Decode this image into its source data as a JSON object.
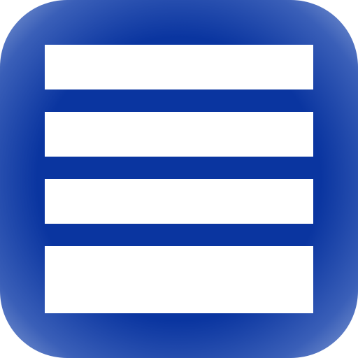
{
  "icon": {
    "name": "list-icon",
    "colors": {
      "accent_deep": "#0a35a0",
      "accent_mid": "#3a5fb8",
      "accent_light": "#8fa6d8",
      "stripe": "#ffffff"
    },
    "stripes": 4
  }
}
